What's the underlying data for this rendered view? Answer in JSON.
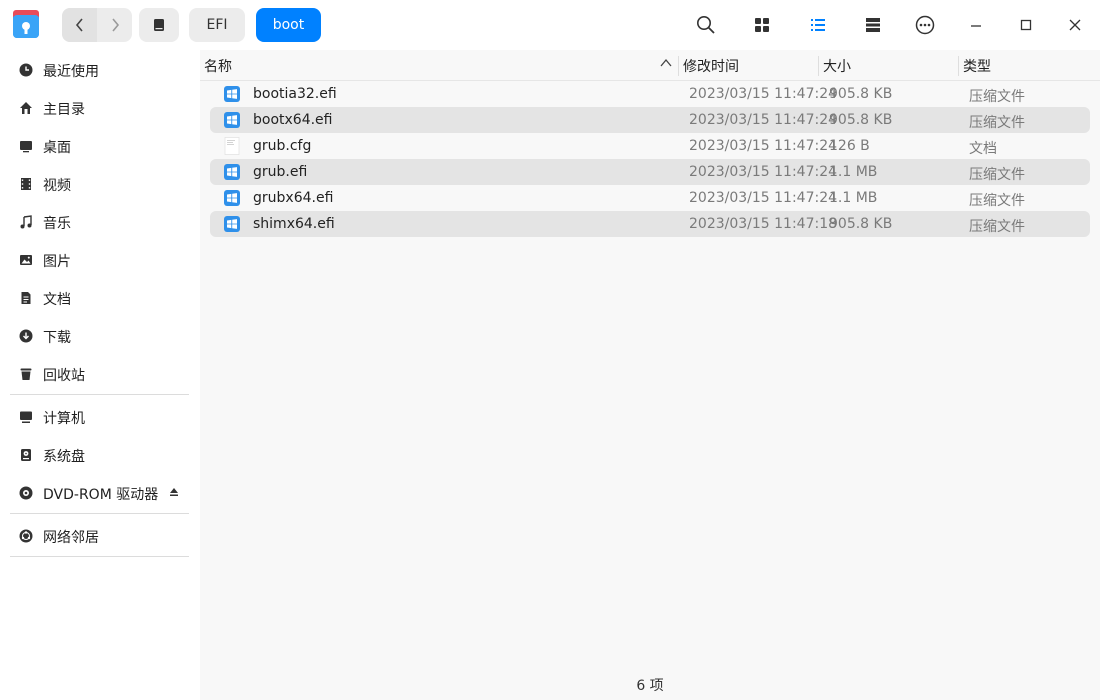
{
  "toolbar": {
    "breadcrumbs": [
      {
        "label": "EFI"
      },
      {
        "label": "boot"
      }
    ],
    "icons": {
      "app": "file-manager-icon",
      "back": "chevron-left-icon",
      "forward": "chevron-right-icon",
      "drive": "drive-icon",
      "search": "search-icon",
      "icon_view": "grid-icon",
      "list_view": "list-icon",
      "detail_view": "detail-panel-icon",
      "menu": "more-icon",
      "minimize": "minimize-icon",
      "maximize": "maximize-icon",
      "close": "close-icon"
    },
    "accent": "#0081ff"
  },
  "sidebar": {
    "items": [
      {
        "label": "最近使用",
        "icon": "clock-icon"
      },
      {
        "label": "主目录",
        "icon": "home-icon"
      },
      {
        "label": "桌面",
        "icon": "desktop-icon"
      },
      {
        "label": "视频",
        "icon": "video-icon"
      },
      {
        "label": "音乐",
        "icon": "music-icon"
      },
      {
        "label": "图片",
        "icon": "picture-icon"
      },
      {
        "label": "文档",
        "icon": "document-icon"
      },
      {
        "label": "下载",
        "icon": "download-icon"
      },
      {
        "label": "回收站",
        "icon": "trash-icon"
      },
      {
        "label": "计算机",
        "icon": "computer-icon"
      },
      {
        "label": "系统盘",
        "icon": "disk-icon"
      },
      {
        "label": "DVD-ROM 驱动器",
        "icon": "dvd-icon"
      },
      {
        "label": "网络邻居",
        "icon": "network-icon"
      }
    ]
  },
  "columns": {
    "name": "名称",
    "modified": "修改时间",
    "size": "大小",
    "type": "类型"
  },
  "files": [
    {
      "name": "bootia32.efi",
      "modified": "2023/03/15 11:47:24",
      "size": "905.8 KB",
      "type": "压缩文件",
      "icon": "efi-file-icon"
    },
    {
      "name": "bootx64.efi",
      "modified": "2023/03/15 11:47:24",
      "size": "905.8 KB",
      "type": "压缩文件",
      "icon": "efi-file-icon"
    },
    {
      "name": "grub.cfg",
      "modified": "2023/03/15 11:47:24",
      "size": "126 B",
      "type": "文档",
      "icon": "text-file-icon"
    },
    {
      "name": "grub.efi",
      "modified": "2023/03/15 11:47:24",
      "size": "1.1 MB",
      "type": "压缩文件",
      "icon": "efi-file-icon"
    },
    {
      "name": "grubx64.efi",
      "modified": "2023/03/15 11:47:24",
      "size": "1.1 MB",
      "type": "压缩文件",
      "icon": "efi-file-icon"
    },
    {
      "name": "shimx64.efi",
      "modified": "2023/03/15 11:47:18",
      "size": "905.8 KB",
      "type": "压缩文件",
      "icon": "efi-file-icon"
    }
  ],
  "status": {
    "count_text": "6 项"
  }
}
